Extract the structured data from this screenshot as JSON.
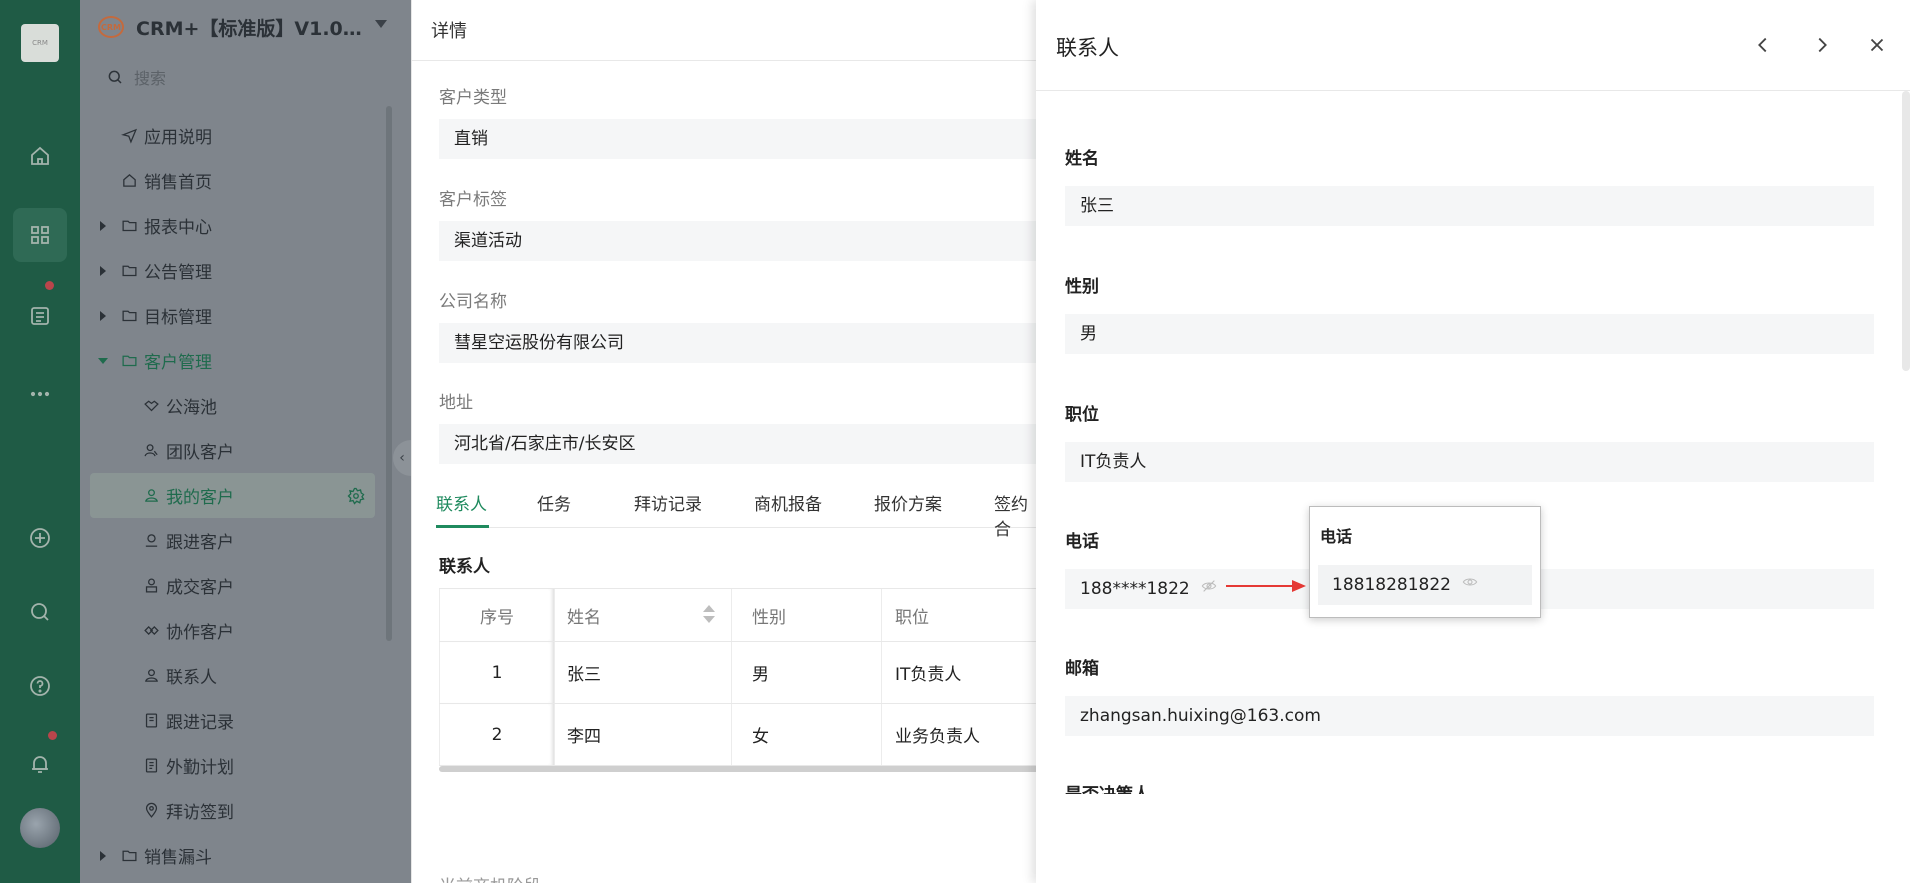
{
  "rail": {
    "logo_text": "CRM",
    "icons": [
      "home-icon",
      "apps-icon",
      "list-icon",
      "more-icon",
      "add-icon",
      "search-icon",
      "help-icon",
      "bell-icon"
    ]
  },
  "sidebar": {
    "app_title": "CRM+【标准版】V1.0…",
    "logo_text": "CRM",
    "search_placeholder": "搜索",
    "items": [
      {
        "label": "应用说明",
        "icon": "send-icon"
      },
      {
        "label": "销售首页",
        "icon": "home-icon"
      },
      {
        "label": "报表中心",
        "icon": "folder-icon"
      },
      {
        "label": "公告管理",
        "icon": "folder-icon"
      },
      {
        "label": "目标管理",
        "icon": "folder-icon"
      },
      {
        "label": "客户管理",
        "icon": "folder-icon"
      },
      {
        "label": "公海池",
        "icon": "handshake-icon"
      },
      {
        "label": "团队客户",
        "icon": "team-icon"
      },
      {
        "label": "我的客户",
        "icon": "user-icon"
      },
      {
        "label": "跟进客户",
        "icon": "follow-icon"
      },
      {
        "label": "成交客户",
        "icon": "deal-icon"
      },
      {
        "label": "协作客户",
        "icon": "collab-icon"
      },
      {
        "label": "联系人",
        "icon": "contact-icon"
      },
      {
        "label": "跟进记录",
        "icon": "record-icon"
      },
      {
        "label": "外勤计划",
        "icon": "plan-icon"
      },
      {
        "label": "拜访签到",
        "icon": "location-icon"
      },
      {
        "label": "销售漏斗",
        "icon": "folder-icon"
      }
    ]
  },
  "detail": {
    "title": "详情",
    "fields": [
      {
        "label": "客户类型",
        "value": "直销"
      },
      {
        "label": "客户标签",
        "value": "渠道活动"
      },
      {
        "label": "公司名称",
        "value": "彗星空运股份有限公司"
      },
      {
        "label": "地址",
        "value": "河北省/石家庄市/长安区"
      }
    ],
    "tabs": [
      "联系人",
      "任务",
      "拜访记录",
      "商机报备",
      "报价方案",
      "签约合"
    ],
    "section_title": "联系人",
    "table": {
      "headers": [
        "序号",
        "姓名",
        "性别",
        "职位"
      ],
      "rows": [
        [
          "1",
          "张三",
          "男",
          "IT负责人"
        ],
        [
          "2",
          "李四",
          "女",
          "业务负责人"
        ]
      ]
    },
    "bottom_label": "当前商机阶段"
  },
  "drawer": {
    "title": "联系人",
    "fields": [
      {
        "label": "姓名",
        "value": "张三"
      },
      {
        "label": "性别",
        "value": "男"
      },
      {
        "label": "职位",
        "value": "IT负责人"
      },
      {
        "label": "电话",
        "value": "188****1822"
      },
      {
        "label": "邮箱",
        "value": "zhangsan.huixing@163.com"
      }
    ],
    "cutoff_label": "是否决策人"
  },
  "popup": {
    "title": "电话",
    "value": "18818281822"
  },
  "colors": {
    "rail": "#1f5b45",
    "accent": "#1f8a5e",
    "arrow": "#e53935"
  }
}
